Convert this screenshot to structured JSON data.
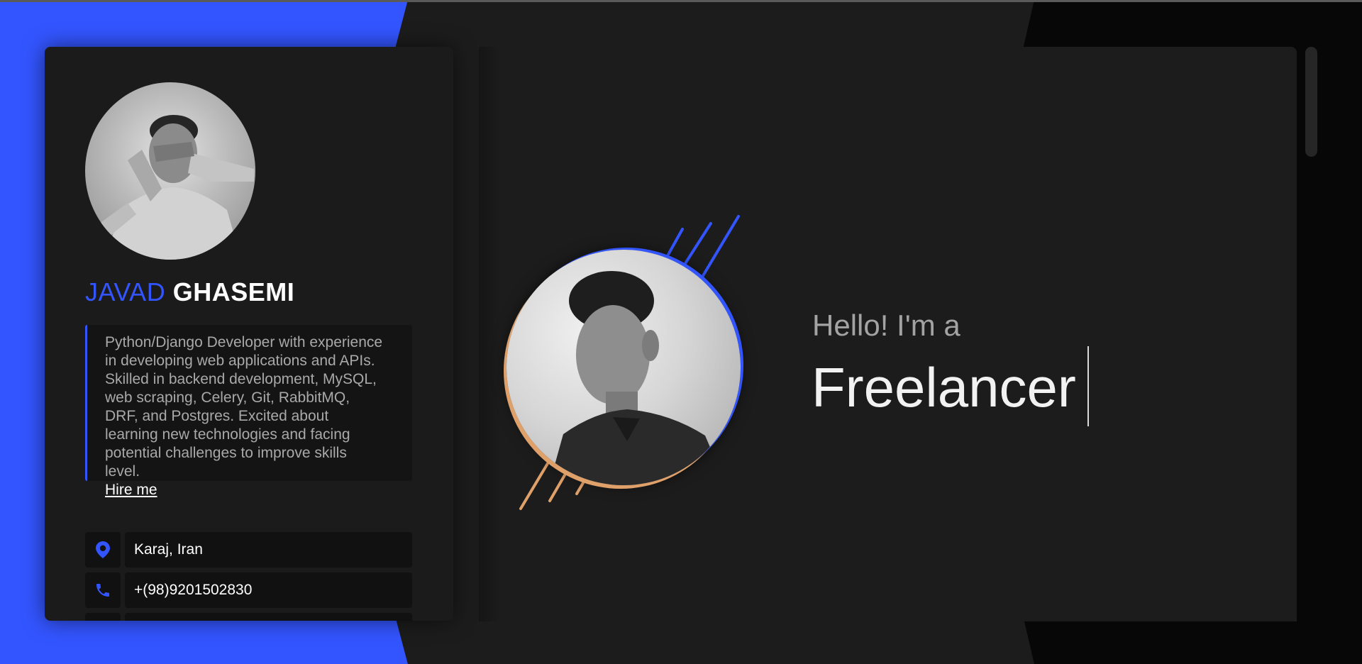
{
  "profile": {
    "first_name": "JAVAD",
    "last_name": "GHASEMI",
    "bio": "Python/Django Developer with experience in developing web applications and APIs. Skilled in backend development, MySQL, web scraping, Celery, Git, RabbitMQ, DRF, and Postgres. Excited about learning new technologies and facing potential challenges to improve skills level.",
    "hire_link": "Hire me",
    "contacts": [
      {
        "icon": "location-pin-icon",
        "value": "Karaj, Iran"
      },
      {
        "icon": "phone-icon",
        "value": "+(98)9201502830"
      },
      {
        "icon": "email-icon",
        "value": ""
      }
    ]
  },
  "hero": {
    "greeting": "Hello! I'm a",
    "role": "Freelancer"
  },
  "colors": {
    "accent_blue": "#3355ff",
    "accent_orange": "#e0a06a",
    "card_bg": "#1b1b1b",
    "field_bg": "#111111"
  }
}
